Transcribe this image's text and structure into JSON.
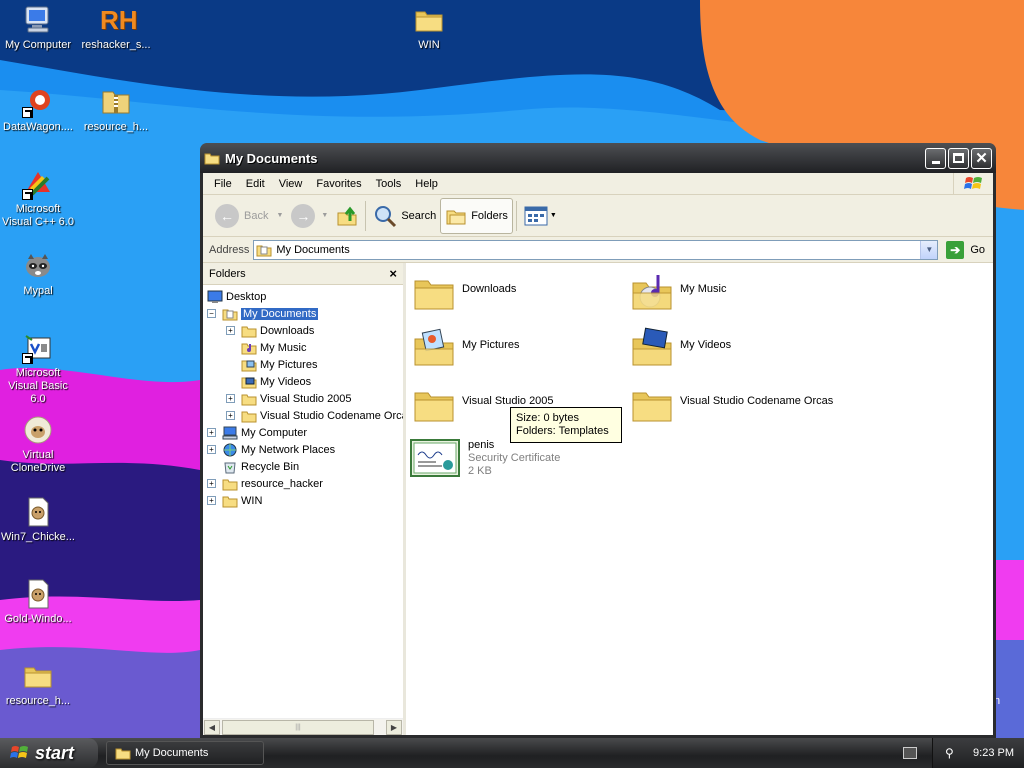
{
  "desktop": {
    "icons": [
      {
        "label": "My Computer"
      },
      {
        "label": "reshacker_s..."
      },
      {
        "label": "WIN"
      },
      {
        "label": "DataWagon...."
      },
      {
        "label": "resource_h..."
      },
      {
        "label": "Microsoft Visual C++ 6.0"
      },
      {
        "label": "Mypal"
      },
      {
        "label": "Microsoft Visual Basic 6.0"
      },
      {
        "label": "Virtual CloneDrive"
      },
      {
        "label": "Win7_Chicke..."
      },
      {
        "label": "Gold-Windo..."
      },
      {
        "label": "resource_h..."
      }
    ],
    "rh_logo_text": "RH",
    "edge_text": "n"
  },
  "window": {
    "title": "My Documents",
    "menu": [
      "File",
      "Edit",
      "View",
      "Favorites",
      "Tools",
      "Help"
    ],
    "toolbar": {
      "back": "Back",
      "search": "Search",
      "folders": "Folders"
    },
    "address": {
      "label": "Address",
      "value": "My Documents",
      "go": "Go"
    },
    "folders_pane": {
      "title": "Folders",
      "close": "×",
      "tree": [
        {
          "label": "Desktop"
        },
        {
          "label": "My Documents"
        },
        {
          "label": "Downloads"
        },
        {
          "label": "My Music"
        },
        {
          "label": "My Pictures"
        },
        {
          "label": "My Videos"
        },
        {
          "label": "Visual Studio 2005"
        },
        {
          "label": "Visual Studio Codename Orcas"
        },
        {
          "label": "My Computer"
        },
        {
          "label": "My Network Places"
        },
        {
          "label": "Recycle Bin"
        },
        {
          "label": "resource_hacker"
        },
        {
          "label": "WIN"
        }
      ]
    },
    "items": [
      {
        "name": "Downloads"
      },
      {
        "name": "My Music"
      },
      {
        "name": "My Pictures"
      },
      {
        "name": "My Videos"
      },
      {
        "name": "Visual Studio 2005"
      },
      {
        "name": "Visual Studio Codename Orcas"
      },
      {
        "name": "penis",
        "type": "Security Certificate",
        "size": "2 KB"
      }
    ],
    "tooltip": {
      "line1": "Size: 0 bytes",
      "line2": "Folders: Templates"
    }
  },
  "taskbar": {
    "start": "start",
    "task": "My Documents",
    "clock": "9:23 PM"
  },
  "colors": {
    "selection": "#316ac5",
    "tooltip_bg": "#ffffe1",
    "window_frame": "#2a2b2d"
  }
}
